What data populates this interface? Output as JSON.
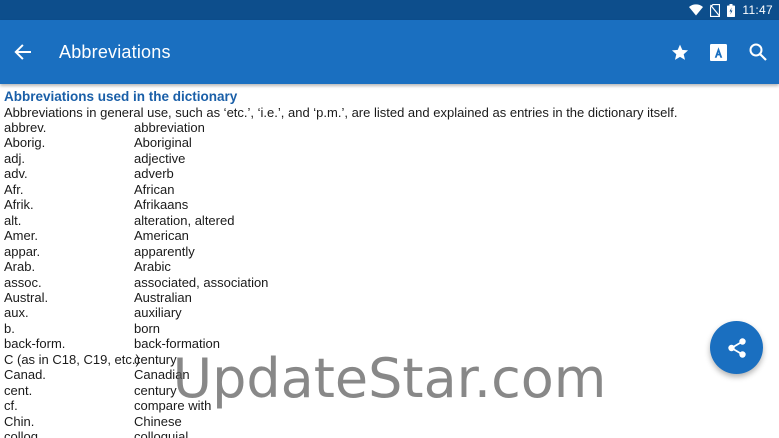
{
  "status_bar": {
    "time": "11:47",
    "icons": [
      "wifi-icon",
      "no-sim-icon",
      "battery-icon"
    ]
  },
  "app_bar": {
    "title": "Abbreviations",
    "navigation_icon": "arrow-left-icon",
    "actions": [
      "star-icon",
      "font-size-icon",
      "search-icon"
    ],
    "color": "#1a6fc0"
  },
  "content": {
    "heading": "Abbreviations used in the dictionary",
    "intro": "Abbreviations in general use, such as ‘etc.’, ‘i.e.’, and ‘p.m.’, are listed and explained as entries in the dictionary itself.",
    "entries": [
      {
        "term": "abbrev.",
        "meaning": "abbreviation"
      },
      {
        "term": "Aborig.",
        "meaning": "Aboriginal"
      },
      {
        "term": "adj.",
        "meaning": "adjective"
      },
      {
        "term": "adv.",
        "meaning": "adverb"
      },
      {
        "term": "Afr.",
        "meaning": "African"
      },
      {
        "term": "Afrik.",
        "meaning": "Afrikaans"
      },
      {
        "term": "alt.",
        "meaning": "alteration, altered"
      },
      {
        "term": "Amer.",
        "meaning": "American"
      },
      {
        "term": "appar.",
        "meaning": "apparently"
      },
      {
        "term": "Arab.",
        "meaning": "Arabic"
      },
      {
        "term": "assoc.",
        "meaning": "associated, association"
      },
      {
        "term": "Austral.",
        "meaning": "Australian"
      },
      {
        "term": "aux.",
        "meaning": "auxiliary"
      },
      {
        "term": "b.",
        "meaning": "born"
      },
      {
        "term": "back-form.",
        "meaning": "back-formation"
      },
      {
        "term": "C (as in C18, C19, etc.)",
        "meaning": "century"
      },
      {
        "term": "Canad.",
        "meaning": "Canadian"
      },
      {
        "term": "cent.",
        "meaning": "century"
      },
      {
        "term": "cf.",
        "meaning": "compare with"
      },
      {
        "term": "Chin.",
        "meaning": "Chinese"
      },
      {
        "term": "colloq.",
        "meaning": "colloquial"
      }
    ]
  },
  "fab": {
    "icon": "share-icon"
  },
  "watermark": "UpdateStar.com"
}
